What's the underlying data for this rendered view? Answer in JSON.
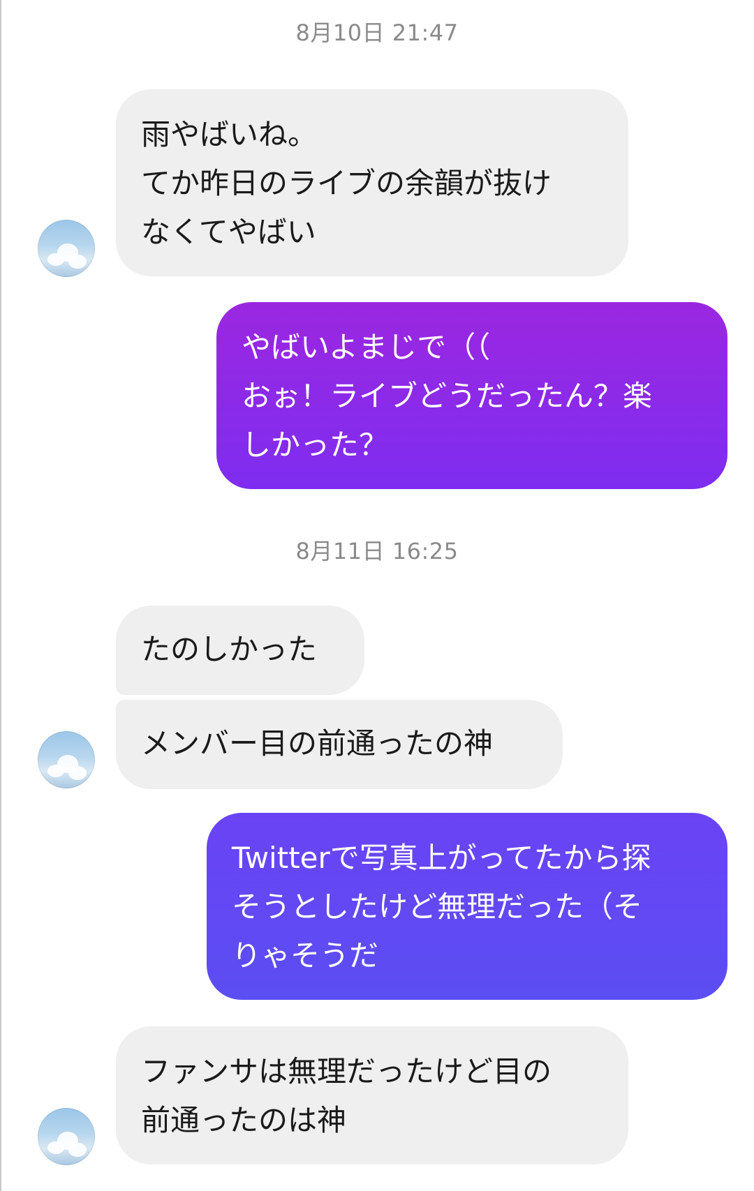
{
  "chat": {
    "timestamps": [
      "8月10日 21:47",
      "8月11日 16:25"
    ],
    "messages": [
      {
        "from": "other",
        "text": "雨やばいね。\nてか昨日のライブの余韻が抜け\nなくてやばい"
      },
      {
        "from": "me",
        "text": "やばいよまじで（（\nおぉ！ライブどうだったん？楽\nしかった？"
      },
      {
        "from": "other",
        "text": "たのしかった"
      },
      {
        "from": "other",
        "text": "メンバー目の前通ったの神"
      },
      {
        "from": "me",
        "text": "Twitterで写真上がってたから探\nそうとしたけど無理だった（そ\nりゃそうだ"
      },
      {
        "from": "other",
        "text": "ファンサは無理だったけど目の\n前通ったのは神"
      }
    ]
  },
  "colors": {
    "incoming_bubble": "#efefef",
    "outgoing_bubble_1_top": "#9b27e0",
    "outgoing_bubble_1_bottom": "#7e2df0",
    "outgoing_bubble_2_top": "#6a43f5",
    "outgoing_bubble_2_bottom": "#5b4ef2",
    "timestamp_text": "#8a8a8a"
  },
  "icons": {
    "avatar": "sky-photo-avatar-icon"
  }
}
